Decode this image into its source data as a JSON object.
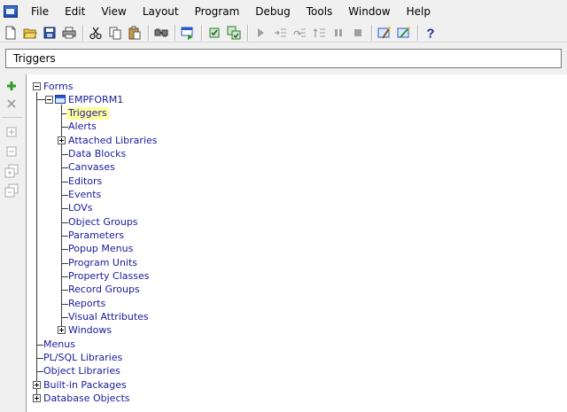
{
  "menubar": {
    "items": [
      "File",
      "Edit",
      "View",
      "Layout",
      "Program",
      "Debug",
      "Tools",
      "Window",
      "Help"
    ]
  },
  "toolbar": {
    "icons": [
      "new-icon",
      "open-icon",
      "save-icon",
      "print-icon",
      "cut-icon",
      "copy-icon",
      "paste-icon",
      "connect-icon",
      "run-form-icon",
      "compile-icon",
      "compile-all-icon",
      "go-icon",
      "step-into-icon",
      "step-over-icon",
      "step-out-icon",
      "pause-icon",
      "stop-icon",
      "wizard-icon",
      "debug-wizard-icon",
      "help-icon"
    ]
  },
  "context": {
    "value": "Triggers"
  },
  "tree": {
    "forms": "Forms",
    "form_module": "EMPFORM1",
    "form_children": [
      "Triggers",
      "Alerts",
      "Attached Libraries",
      "Data Blocks",
      "Canvases",
      "Editors",
      "Events",
      "LOVs",
      "Object Groups",
      "Parameters",
      "Popup Menus",
      "Program Units",
      "Property Classes",
      "Record Groups",
      "Reports",
      "Visual Attributes",
      "Windows"
    ],
    "top_level": [
      "Menus",
      "PL/SQL Libraries",
      "Object Libraries",
      "Built-in Packages",
      "Database Objects"
    ]
  },
  "colors": {
    "node_text": "#1a1a9a",
    "selection": "#ffff9c",
    "add": "#2e9a2e"
  }
}
